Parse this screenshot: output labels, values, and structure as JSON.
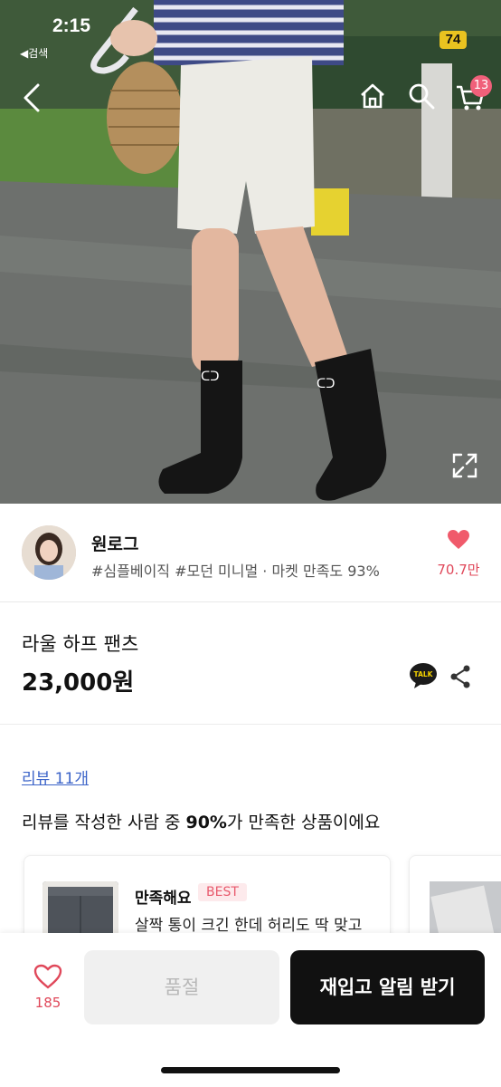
{
  "status_bar": {
    "time": "2:15",
    "back_app": "◀검색",
    "battery": "74"
  },
  "header": {
    "cart_count": "13"
  },
  "seller": {
    "name": "원로그",
    "tags": "#심플베이직 #모던 미니멀 · 마켓 만족도 93%",
    "likes": "70.7만"
  },
  "product": {
    "name": "라울 하프 팬츠",
    "price": "23,000원",
    "talk_label": "TALK"
  },
  "reviews": {
    "link": "리뷰 11개",
    "summary_prefix": "리뷰를 작성한 사람 중 ",
    "summary_highlight": "90%",
    "summary_suffix": "가 만족한 상품이에요",
    "cards": [
      {
        "status": "만족해요",
        "badge": "BEST",
        "text": "살짝 통이 크긴 한데 허리도 딱 맞고"
      }
    ]
  },
  "bottom_bar": {
    "wish_count": "185",
    "soldout_label": "품절",
    "restock_label": "재입고 알림 받기"
  },
  "colors": {
    "accent_red": "#e0485a",
    "link_blue": "#3b63c8",
    "cta_black": "#111111",
    "battery_yellow": "#e9c320"
  },
  "icons": [
    "back-arrow-icon",
    "home-icon",
    "search-icon",
    "cart-icon",
    "expand-icon",
    "heart-icon",
    "kakaotalk-icon",
    "share-icon"
  ]
}
